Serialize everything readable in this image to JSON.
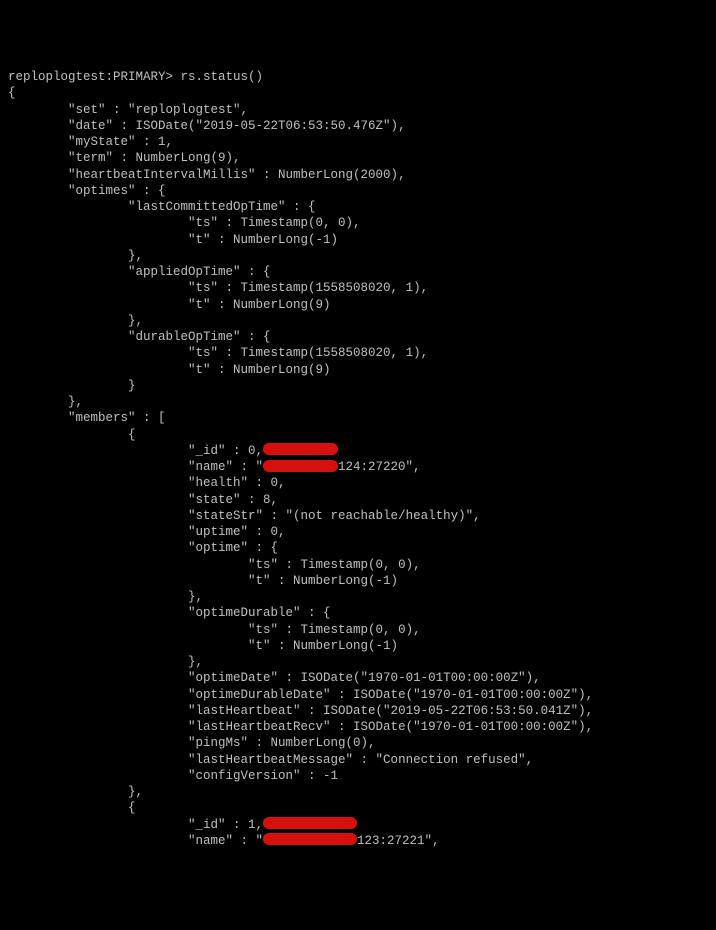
{
  "prompt": "reploplogtest:PRIMARY>",
  "command": "rs.status()",
  "l0": "{",
  "kv1": "        \"set\" : \"reploplogtest\",",
  "kv2": "        \"date\" : ISODate(\"2019-05-22T06:53:50.476Z\"),",
  "kv3": "        \"myState\" : 1,",
  "kv4": "        \"term\" : NumberLong(9),",
  "kv5": "        \"heartbeatIntervalMillis\" : NumberLong(2000),",
  "kv6": "        \"optimes\" : {",
  "kv7": "                \"lastCommittedOpTime\" : {",
  "kv8": "                        \"ts\" : Timestamp(0, 0),",
  "kv9": "                        \"t\" : NumberLong(-1)",
  "kv10": "                },",
  "kv11": "                \"appliedOpTime\" : {",
  "kv12": "                        \"ts\" : Timestamp(1558508020, 1),",
  "kv13": "                        \"t\" : NumberLong(9)",
  "kv14": "                },",
  "kv15": "                \"durableOpTime\" : {",
  "kv16": "                        \"ts\" : Timestamp(1558508020, 1),",
  "kv17": "                        \"t\" : NumberLong(9)",
  "kv18": "                }",
  "kv19": "        },",
  "kv20": "        \"members\" : [",
  "kv21": "                {",
  "kv22": "                        \"_id\" : 0,",
  "kv23a": "                        \"name\" : \"",
  "kv23b": "124:27220\",",
  "kv24": "                        \"health\" : 0,",
  "kv25": "                        \"state\" : 8,",
  "kv26": "                        \"stateStr\" : \"(not reachable/healthy)\",",
  "kv27": "                        \"uptime\" : 0,",
  "kv28": "                        \"optime\" : {",
  "kv29": "                                \"ts\" : Timestamp(0, 0),",
  "kv30": "                                \"t\" : NumberLong(-1)",
  "kv31": "                        },",
  "kv32": "                        \"optimeDurable\" : {",
  "kv33": "                                \"ts\" : Timestamp(0, 0),",
  "kv34": "                                \"t\" : NumberLong(-1)",
  "kv35": "                        },",
  "kv36": "                        \"optimeDate\" : ISODate(\"1970-01-01T00:00:00Z\"),",
  "kv37": "                        \"optimeDurableDate\" : ISODate(\"1970-01-01T00:00:00Z\"),",
  "kv38": "                        \"lastHeartbeat\" : ISODate(\"2019-05-22T06:53:50.041Z\"),",
  "kv39": "                        \"lastHeartbeatRecv\" : ISODate(\"1970-01-01T00:00:00Z\"),",
  "kv40": "                        \"pingMs\" : NumberLong(0),",
  "kv41": "                        \"lastHeartbeatMessage\" : \"Connection refused\",",
  "kv42": "                        \"configVersion\" : -1",
  "kv43": "                },",
  "kv44": "                {",
  "kv45": "                        \"_id\" : 1,",
  "kv46a": "                        \"name\" : \"",
  "kv46b": "123:27221\","
}
